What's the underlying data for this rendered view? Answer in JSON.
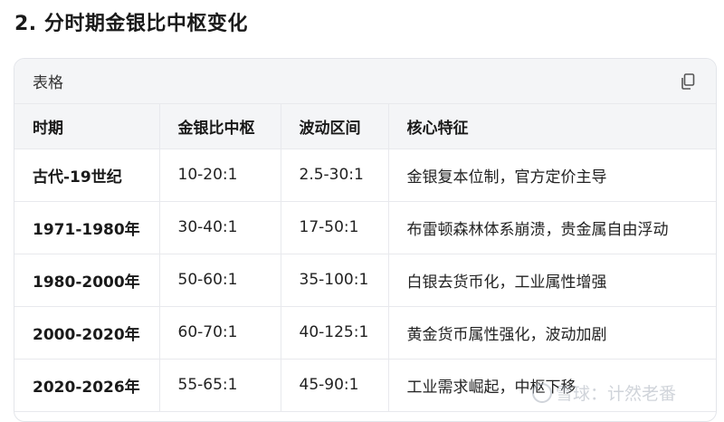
{
  "heading": "2. 分时期金银比中枢变化",
  "table": {
    "title": "表格",
    "copy_icon": "copy-icon",
    "headers": [
      "时期",
      "金银比中枢",
      "波动区间",
      "核心特征"
    ],
    "rows": [
      [
        "古代-19世纪",
        "10-20:1",
        "2.5-30:1",
        "金银复本位制，官方定价主导"
      ],
      [
        "1971-1980年",
        "30-40:1",
        "17-50:1",
        "布雷顿森林体系崩溃，贵金属自由浮动"
      ],
      [
        "1980-2000年",
        "50-60:1",
        "35-100:1",
        "白银去货币化，工业属性增强"
      ],
      [
        "2000-2020年",
        "60-70:1",
        "40-125:1",
        "黄金货币属性强化，波动加剧"
      ],
      [
        "2020-2026年",
        "55-65:1",
        "45-90:1",
        "工业需求崛起，中枢下移"
      ]
    ]
  },
  "watermark": "雪球：计然老番"
}
